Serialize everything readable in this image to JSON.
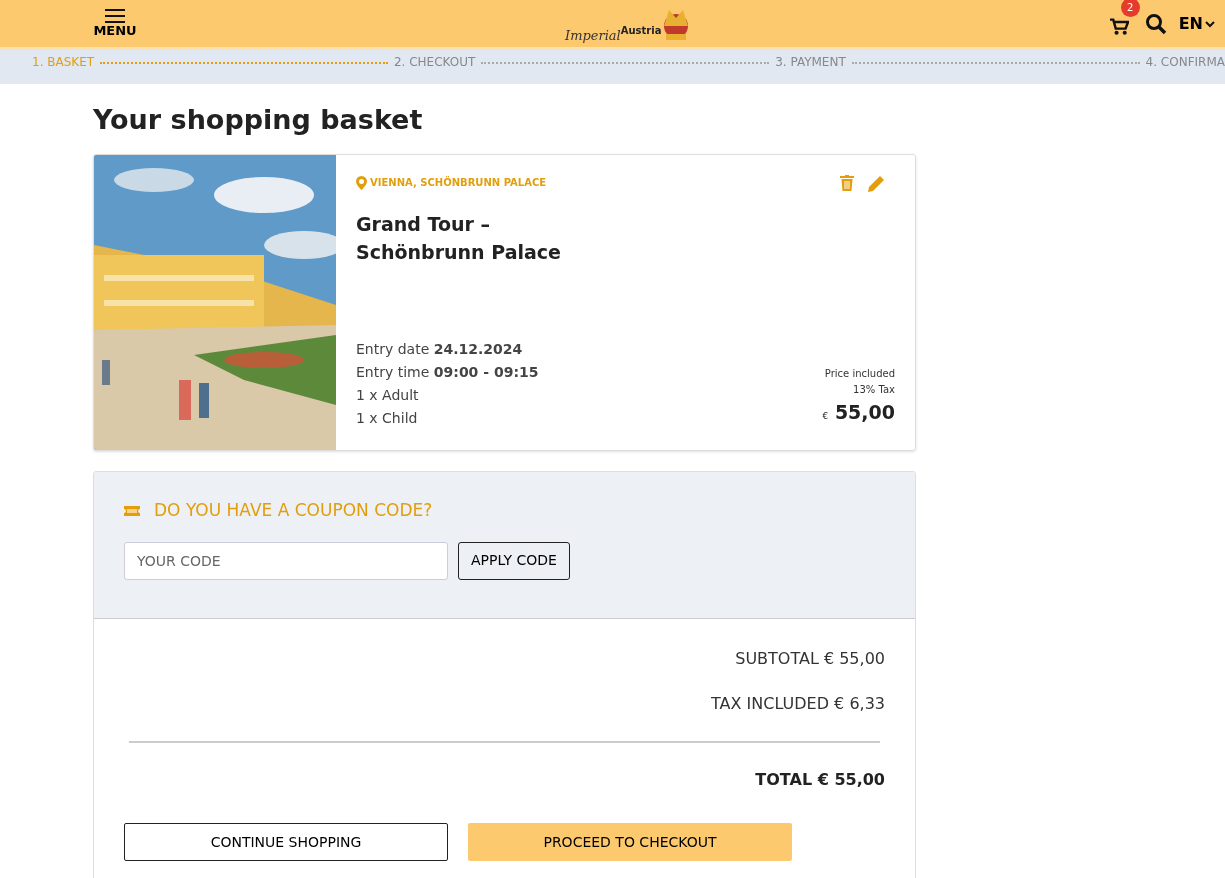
{
  "header": {
    "menu_label": "MENU",
    "logo": {
      "word_1": "Imperial",
      "word_2": "Austria"
    },
    "cart_count": "2",
    "language": "EN"
  },
  "steps": [
    {
      "label": "1. BASKET",
      "selected": true
    },
    {
      "label": "2. CHECKOUT",
      "selected": false
    },
    {
      "label": "3. PAYMENT",
      "selected": false
    },
    {
      "label": "4. CONFIRMA",
      "selected": false
    }
  ],
  "page_title": "Your shopping basket",
  "basket_item": {
    "location": "VIENNA, SCHÖNBRUNN PALACE",
    "title_line_1": "Grand Tour –",
    "title_line_2": "Schönbrunn Palace",
    "details": [
      {
        "label": "Entry date",
        "value": "24.12.2024"
      },
      {
        "label": "Entry time",
        "value": "09:00 - 09:15"
      },
      {
        "label": "1 x Adult"
      },
      {
        "label": "1 x Child"
      }
    ],
    "price_note_1": "Price included",
    "price_note_2": "13% Tax",
    "currency": "€",
    "price": "55,00"
  },
  "coupon": {
    "heading": "DO YOU HAVE A COUPON CODE?",
    "placeholder": "YOUR CODE",
    "button": "APPLY CODE"
  },
  "totals": {
    "subtotal": "SUBTOTAL € 55,00",
    "tax": "TAX INCLUDED € 6,33",
    "total": "TOTAL € 55,00"
  },
  "buttons": {
    "continue": "CONTINUE SHOPPING",
    "checkout": "PROCEED TO CHECKOUT"
  }
}
